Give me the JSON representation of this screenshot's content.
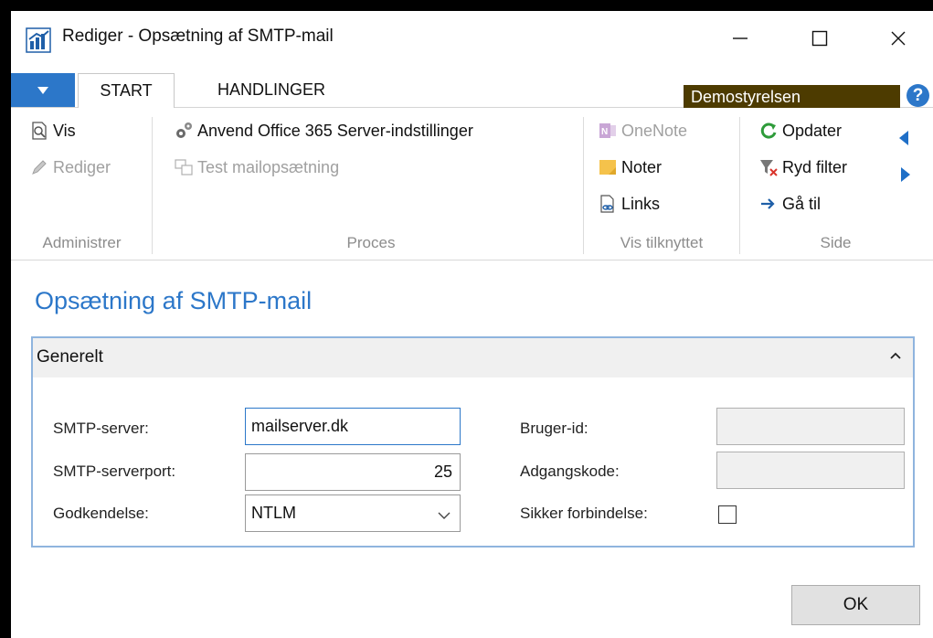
{
  "window": {
    "title": "Rediger - Opsætning af SMTP-mail",
    "minimize_icon": "minimize-icon",
    "maximize_icon": "maximize-icon",
    "close_icon": "close-icon"
  },
  "tabs": {
    "dropdown_icon": "caret-down-icon",
    "items": [
      {
        "label": "START",
        "selected": true
      },
      {
        "label": "HANDLINGER",
        "selected": false
      }
    ],
    "company": "Demostyrelsen",
    "help_icon": "?"
  },
  "ribbon": {
    "groups": [
      {
        "label": "Administrer",
        "buttons": [
          {
            "label": "Vis",
            "icon": "view-icon",
            "enabled": true
          },
          {
            "label": "Rediger",
            "icon": "pencil-icon",
            "enabled": false
          }
        ]
      },
      {
        "label": "Proces",
        "buttons": [
          {
            "label": "Anvend Office 365 Server-indstillinger",
            "icon": "gears-icon",
            "enabled": true
          },
          {
            "label": "Test mailopsætning",
            "icon": "test-mail-icon",
            "enabled": false
          }
        ]
      },
      {
        "label": "Vis tilknyttet",
        "buttons": [
          {
            "label": "OneNote",
            "icon": "onenote-icon",
            "enabled": false
          },
          {
            "label": "Noter",
            "icon": "note-icon",
            "enabled": true
          },
          {
            "label": "Links",
            "icon": "link-icon",
            "enabled": true
          }
        ]
      },
      {
        "label": "Side",
        "buttons": [
          {
            "label": "Opdater",
            "icon": "refresh-icon",
            "enabled": true
          },
          {
            "label": "Ryd filter",
            "icon": "clear-filter-icon",
            "enabled": true
          },
          {
            "label": "Gå til",
            "icon": "arrow-right-icon",
            "enabled": true
          }
        ],
        "nav_icons": [
          "previous-icon",
          "next-icon"
        ]
      }
    ]
  },
  "page": {
    "title": "Opsætning af SMTP-mail",
    "fasttab": {
      "title": "Generelt",
      "collapse_icon": "chevron-up-icon",
      "fields": {
        "smtp_server": {
          "label": "SMTP-server:",
          "value": "mailserver.dk"
        },
        "smtp_port": {
          "label": "SMTP-serverport:",
          "value": "25"
        },
        "authentication": {
          "label": "Godkendelse:",
          "value": "NTLM"
        },
        "user_id": {
          "label": "Bruger-id:",
          "value": ""
        },
        "password": {
          "label": "Adgangskode:",
          "value": ""
        },
        "secure_connection": {
          "label": "Sikker forbindelse:",
          "checked": false
        }
      }
    }
  },
  "footer": {
    "ok_label": "OK"
  },
  "colors": {
    "accent": "#2c77c9",
    "company_bg": "#4d3b00",
    "disabled_text": "#a0a0a0"
  }
}
